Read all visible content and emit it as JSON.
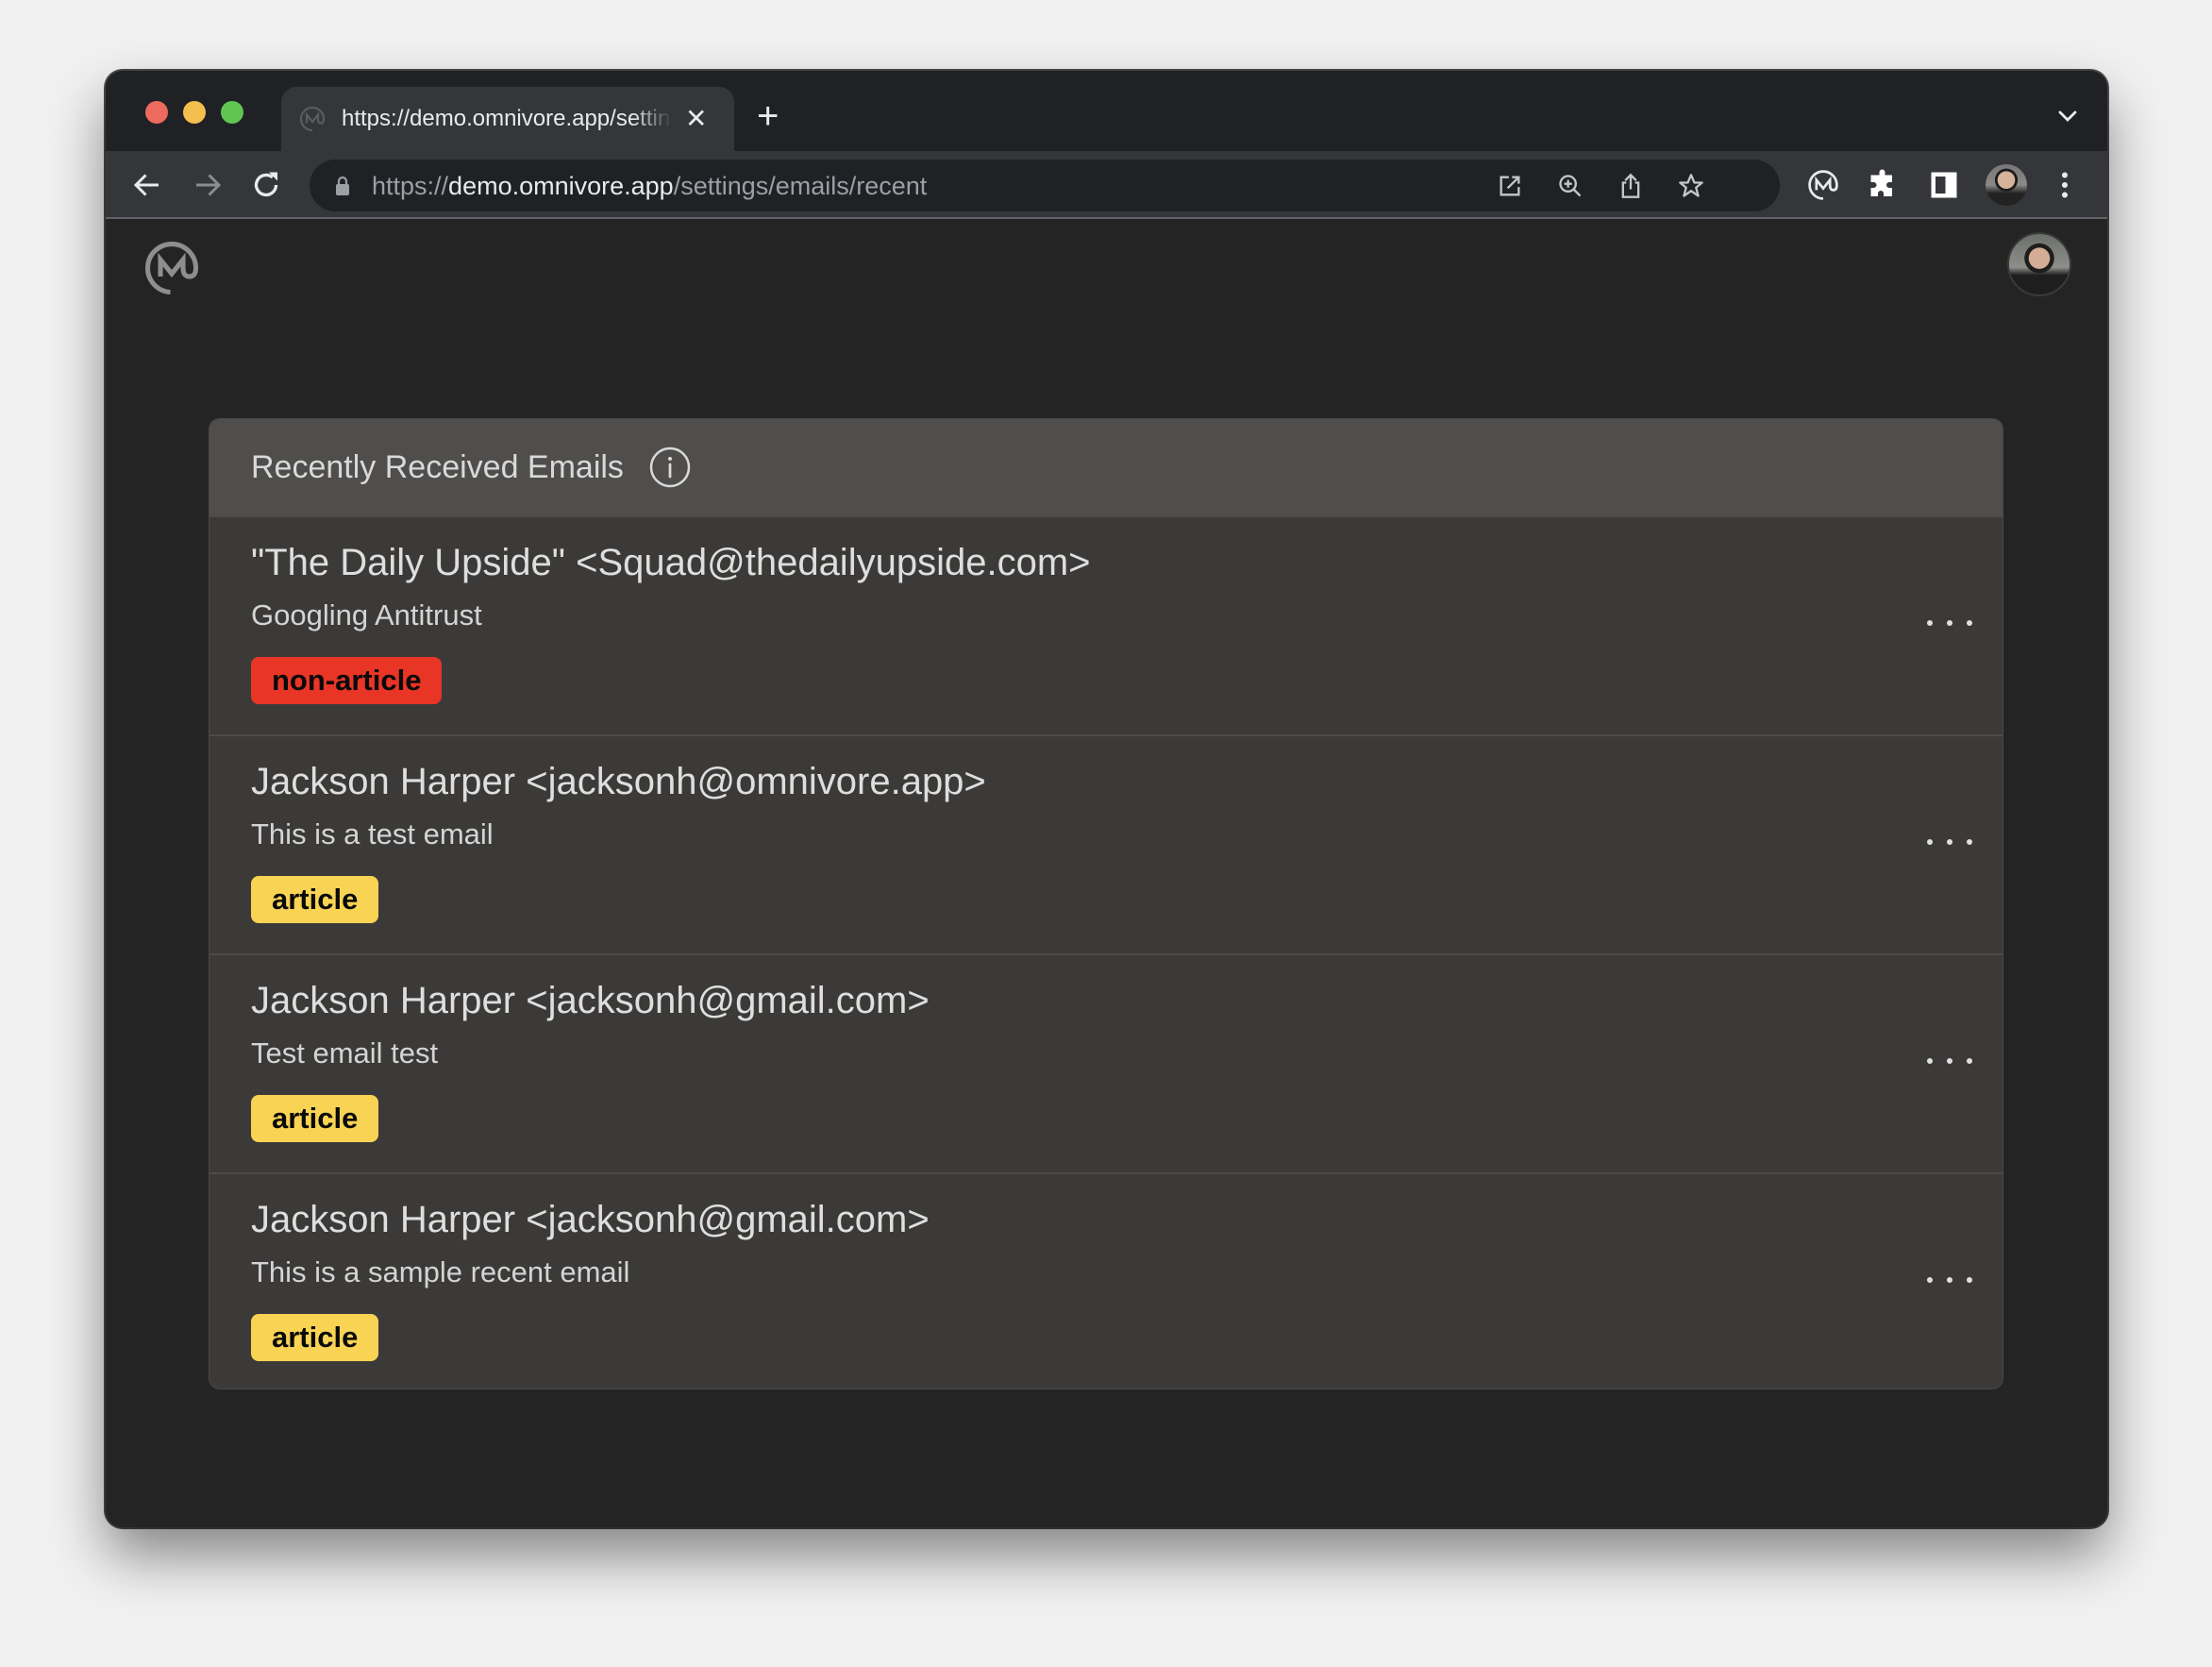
{
  "browser": {
    "tab": {
      "title": "https://demo.omnivore.app/settings/emails/recent",
      "favicon": "omnivore-logo-icon"
    },
    "address_bar": {
      "scheme": "https://",
      "host": "demo.omnivore.app",
      "path": "/settings/emails/recent"
    },
    "icons": {
      "back": "arrow-left-icon",
      "forward": "arrow-right-icon",
      "reload": "reload-icon",
      "lock": "lock-icon",
      "open_in_app": "external-link-icon",
      "zoom": "zoom-in-icon",
      "share": "share-icon",
      "bookmark": "star-icon",
      "extension_omnivore": "omnivore-logo-icon",
      "extensions": "puzzle-icon",
      "side_panel": "side-panel-icon",
      "profile": "profile-avatar",
      "menu": "kebab-menu-icon",
      "new_tab": "plus-icon",
      "tab_search": "chevron-down-icon"
    }
  },
  "app": {
    "logo": "omnivore-logo-icon",
    "user_avatar": "user-avatar"
  },
  "card": {
    "title": "Recently Received Emails",
    "info_icon": "info-icon"
  },
  "colors": {
    "non_article": "#e83526",
    "article": "#f9d354"
  },
  "emails": [
    {
      "from": "\"The Daily Upside\" <Squad@thedailyupside.com>",
      "subject": "Googling Antitrust",
      "type": "non-article"
    },
    {
      "from": "Jackson Harper <jacksonh@omnivore.app>",
      "subject": "This is a test email",
      "type": "article"
    },
    {
      "from": "Jackson Harper <jacksonh@gmail.com>",
      "subject": "Test email test",
      "type": "article"
    },
    {
      "from": "Jackson Harper <jacksonh@gmail.com>",
      "subject": "This is a sample recent email",
      "type": "article"
    }
  ]
}
